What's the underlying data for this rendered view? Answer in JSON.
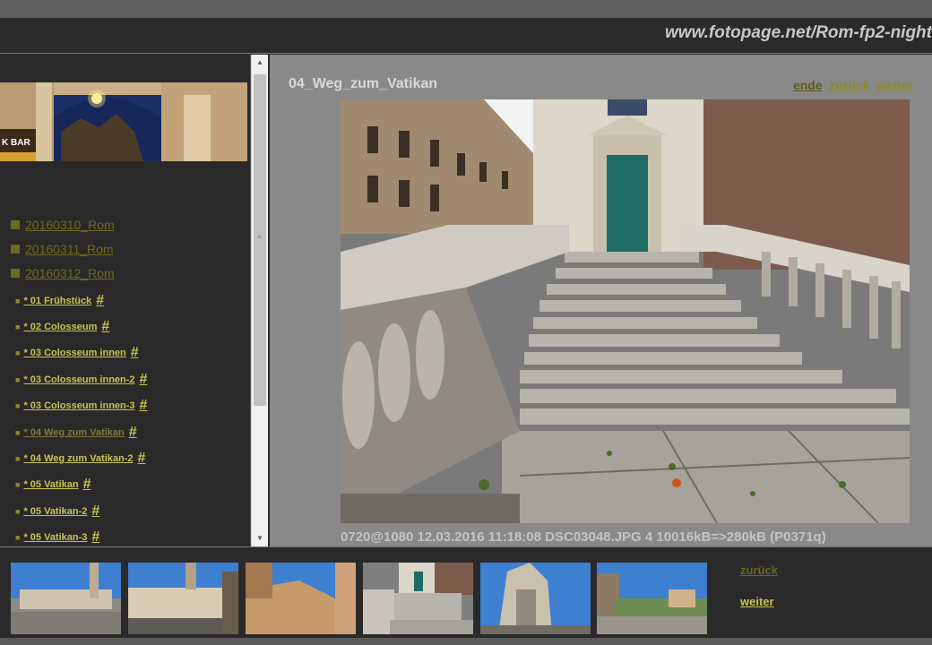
{
  "header": {
    "url": "www.fotopage.net/Rom-fp2-night"
  },
  "sidebar": {
    "dates": [
      {
        "label": "20160310_Rom"
      },
      {
        "label": "20160311_Rom"
      },
      {
        "label": "20160312_Rom"
      }
    ],
    "items": [
      {
        "label": "* 01  Frühstück",
        "hash": "#"
      },
      {
        "label": "* 02  Colosseum",
        "hash": "#"
      },
      {
        "label": "* 03  Colosseum  innen",
        "hash": "#"
      },
      {
        "label": "* 03  Colosseum  innen-2",
        "hash": "#"
      },
      {
        "label": "* 03  Colosseum  innen-3",
        "hash": "#"
      },
      {
        "label": "* 04  Weg  zum  Vatikan",
        "hash": "#"
      },
      {
        "label": "* 04  Weg  zum  Vatikan-2",
        "hash": "#"
      },
      {
        "label": "* 05  Vatikan",
        "hash": "#"
      },
      {
        "label": "* 05  Vatikan-2",
        "hash": "#"
      },
      {
        "label": "* 05  Vatikan-3",
        "hash": "#"
      }
    ]
  },
  "main": {
    "title": "04_Weg_zum_Vatikan",
    "nav": {
      "ende": "ende",
      "zurueck": "zurück",
      "weiter": "weiter"
    },
    "info": "0720@1080 12.03.2016 11:18:08 DSC03048.JPG 4 10016kB=>280kB (P0371q)"
  },
  "filmstrip": {
    "zurueck": "zurück",
    "weiter": "weiter"
  },
  "colors": {
    "link_dim": "#6b6a1f",
    "link_bright": "#c8c451",
    "nav_dark": "#5a5a18",
    "nav_olive": "#8e8a2a"
  }
}
